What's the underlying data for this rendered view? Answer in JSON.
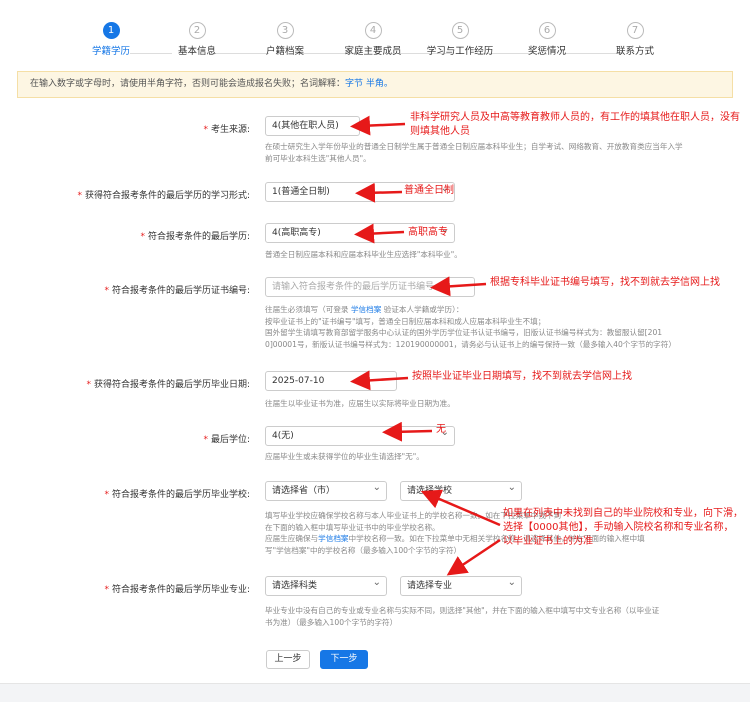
{
  "steps": [
    {
      "num": "1",
      "label": "学籍学历"
    },
    {
      "num": "2",
      "label": "基本信息"
    },
    {
      "num": "3",
      "label": "户籍档案"
    },
    {
      "num": "4",
      "label": "家庭主要成员"
    },
    {
      "num": "5",
      "label": "学习与工作经历"
    },
    {
      "num": "6",
      "label": "奖惩情况"
    },
    {
      "num": "7",
      "label": "联系方式"
    }
  ],
  "notice": {
    "text": "在输入数字或字母时，请使用半角字符，否则可能会造成报名失败；名词解释：",
    "link": "字节 半角。"
  },
  "form": {
    "source": {
      "label": "考生来源:",
      "value": "4(其他在职人员)",
      "hint": "在硕士研究生入学年份毕业的普通全日制学生属于普通全日制应届本科毕业生；自学考试、网络教育、开放教育类应当年入学前可毕业本科生选\"其他人员\"。"
    },
    "study_form": {
      "label": "获得符合报考条件的最后学历的学习形式:",
      "value": "1(普通全日制)"
    },
    "last_edu": {
      "label": "符合报考条件的最后学历:",
      "value": "4(高职高专)",
      "hint": "普通全日制应届本科和应届本科毕业生应选择\"本科毕业\"。"
    },
    "cert_no": {
      "label": "符合报考条件的最后学历证书编号:",
      "placeholder": "请输入符合报考条件的最后学历证书编号",
      "hint1": "往届生必须填写（可登录",
      "hint1_link": "学信档案",
      "hint1_end": "验证本人学籍或学历）：",
      "hint2": "按毕业证书上的\"证书编号\"填写，普通全日制应届本科和成人应届本科毕业生不填；",
      "hint3": "国外留学生请填写教育部留学服务中心认证的国外学历学位证书认证书编号，旧版认证书编号样式为：教留服认留[201",
      "hint4": "0]00001号，新版认证书编号样式为：120190000001，请务必与认证书上的编号保持一致（最多输入40个字节的字符）"
    },
    "grad_date": {
      "label": "获得符合报考条件的最后学历毕业日期:",
      "value": "2025-07-10",
      "hint": "往届生以毕业证书为准，应届生以实际将毕业日期为准。"
    },
    "degree": {
      "label": "最后学位:",
      "value": "4(无)",
      "hint": "应届毕业生或未获得学位的毕业生请选择\"无\"。"
    },
    "school": {
      "label": "符合报考条件的最后学历毕业学校:",
      "province": "请选择省（市）",
      "school": "请选择学校",
      "hint1": "填写毕业学校应确保学校名称与本人毕业证书上的学校名称一致。如在下拉菜单中找不到",
      "hint2": "在下面的输入框中填写毕业证书中的毕业学校名称。",
      "hint3": "应届生应确保与",
      "hint3_link": "学信档案",
      "hint3_end": "中学校名称一致。如在下拉菜单中无相关学校名称，请选择其他，并在下面的输入框中填",
      "hint4": "写\"学信档案\"中的学校名称（最多输入100个字节的字符）"
    },
    "major": {
      "label": "符合报考条件的最后学历毕业专业:",
      "category": "请选择科类",
      "major": "请选择专业",
      "hint1": "毕业专业中没有自己的专业或专业名称与实际不同，则选择\"其他\"，并在下面的输入框中填写中文专业名称（以毕业证",
      "hint2": "书为准）（最多输入100个字节的字符）"
    }
  },
  "buttons": {
    "prev": "上一步",
    "next": "下一步"
  },
  "annotations": {
    "a1": "非科学研究人员及中高等教育教师人员的，有工作的填其他在职人员，没有则填其他人员",
    "a2": "普通全日制",
    "a3": "高职高专",
    "a4": "根据专科毕业证书编号填写，找不到就去学信网上找",
    "a5": "按照毕业证毕业日期填写，找不到就去学信网上找",
    "a6": "无",
    "a7": "如果在列表中未找到自己的毕业院校和专业，向下滑，选择【0000其他】，手动输入院校名称和专业名称，以毕业证书上的为准"
  },
  "colors": {
    "accent": "#1677e6",
    "annotation": "#e61919",
    "required": "#e62020"
  }
}
